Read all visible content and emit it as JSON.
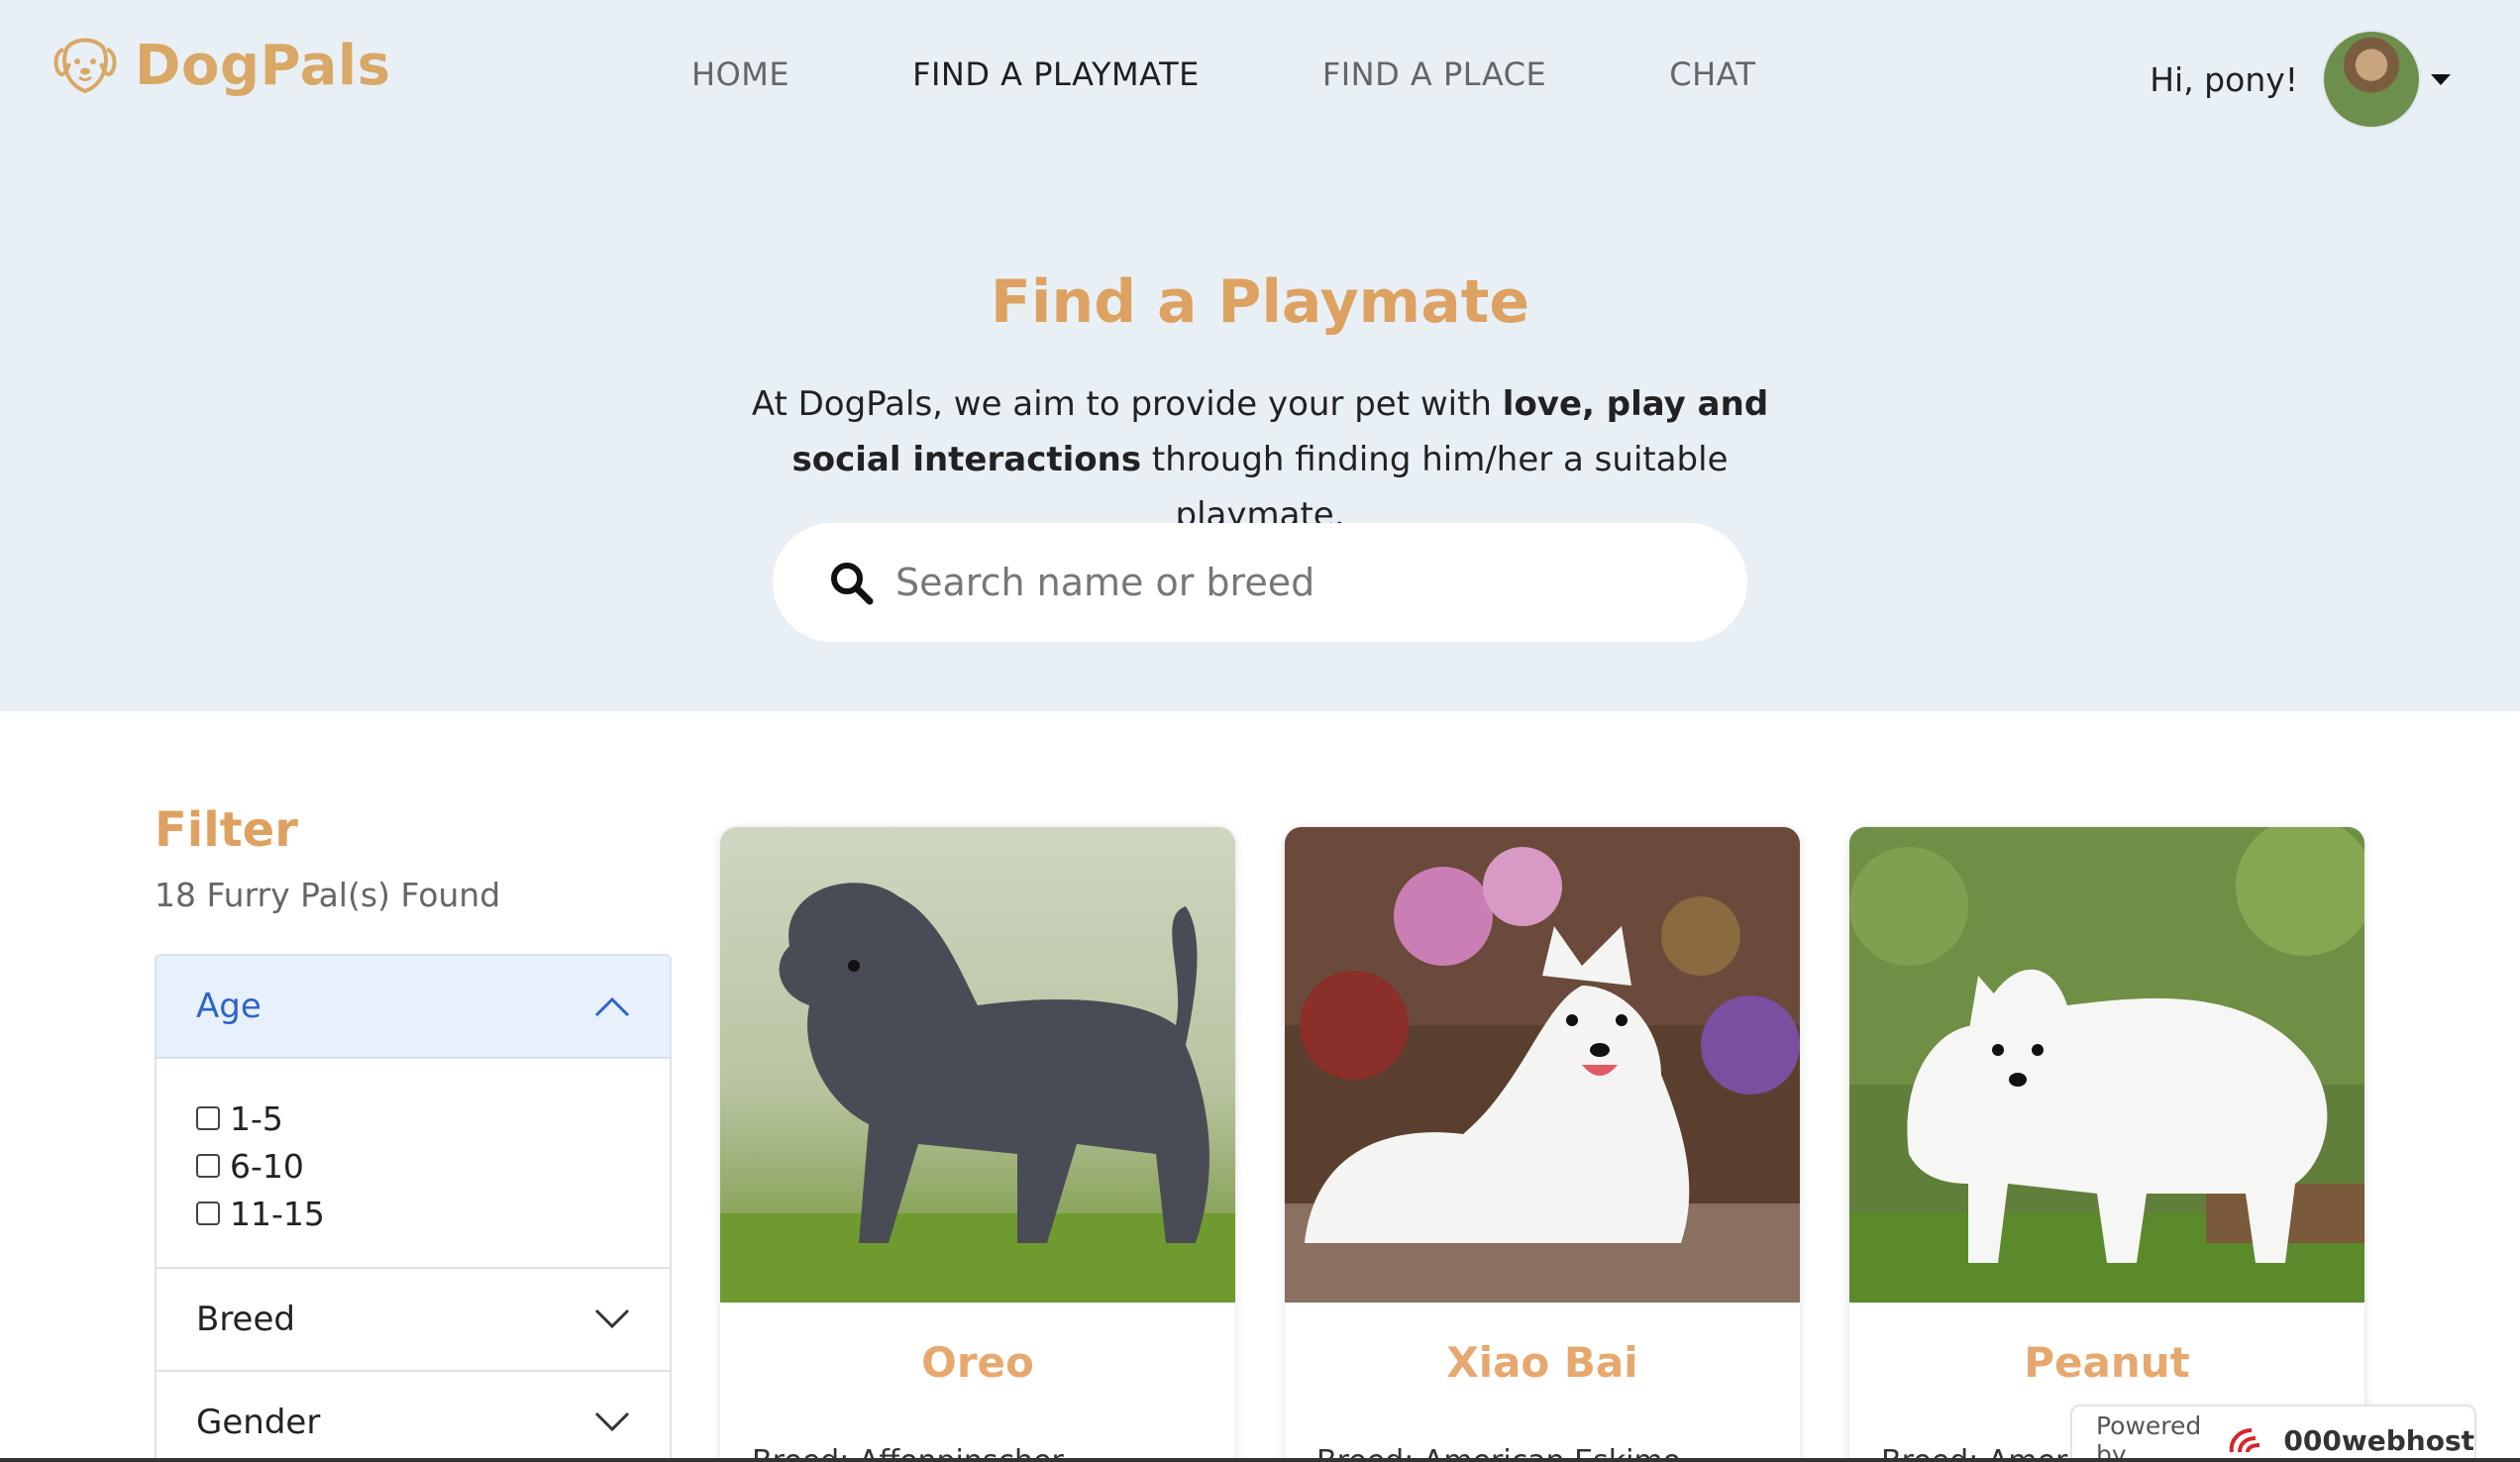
{
  "header": {
    "brand": "DogPals",
    "nav": [
      {
        "label": "HOME",
        "active": false
      },
      {
        "label": "FIND A PLAYMATE",
        "active": true
      },
      {
        "label": "FIND A PLACE",
        "active": false
      },
      {
        "label": "CHAT",
        "active": false
      }
    ],
    "greeting": "Hi, pony!"
  },
  "hero": {
    "title": "Find a Playmate",
    "desc_part1": "At DogPals, we aim to provide your pet with ",
    "desc_bold": "love, play and social interactions",
    "desc_part2": " through finding him/her a suitable playmate.",
    "search_placeholder": "Search name or breed"
  },
  "filter": {
    "title": "Filter",
    "count": "18 Furry Pal(s) Found",
    "sections": [
      {
        "label": "Age",
        "open": true,
        "options": [
          "1-5",
          "6-10",
          "11-15"
        ]
      },
      {
        "label": "Breed",
        "open": false
      },
      {
        "label": "Gender",
        "open": false
      }
    ]
  },
  "cards": [
    {
      "name": "Oreo",
      "breed": "Breed: Affenpinscher"
    },
    {
      "name": "Xiao Bai",
      "breed": "Breed: American Eskimo"
    },
    {
      "name": "Peanut",
      "breed": "Breed: American Eskimo"
    }
  ],
  "badge": {
    "powered": "Powered by",
    "brand": "000webhost"
  },
  "colors": {
    "brand": "#d9a866",
    "hero_bg": "#e8f0f6",
    "card_name": "#e7a86f",
    "accordion_active": "#2d64c8"
  }
}
